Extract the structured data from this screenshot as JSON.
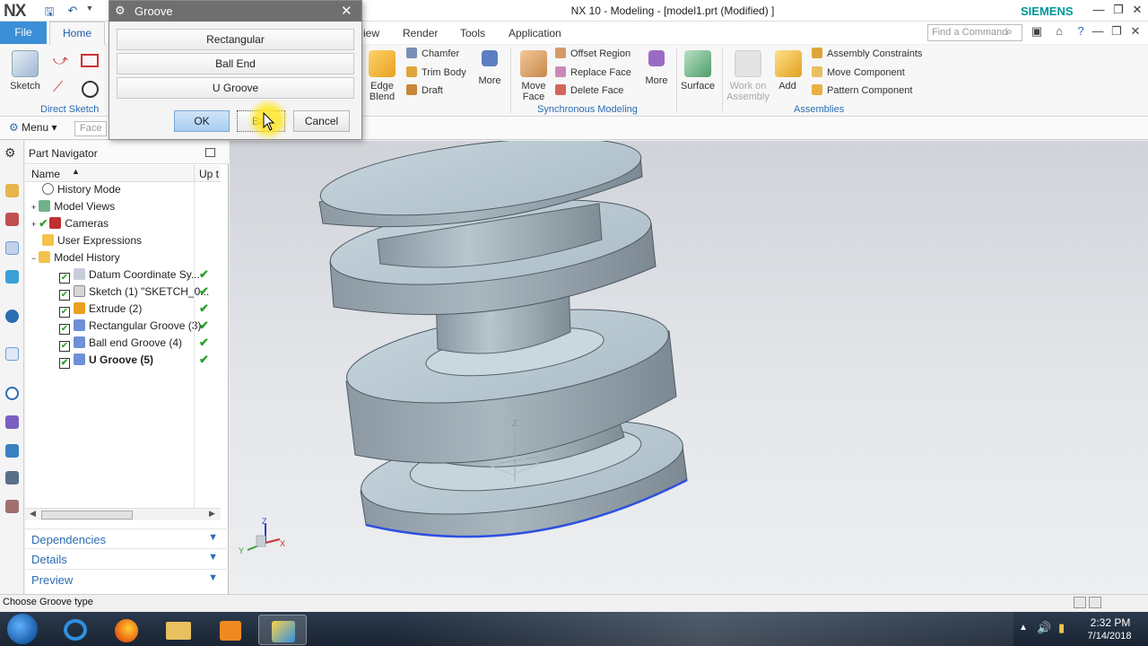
{
  "window": {
    "logo": "NX",
    "title": "NX 10 - Modeling - [model1.prt (Modified) ]",
    "brand": "SIEMENS",
    "accent": "#3b8fd6",
    "brand_color": "#00969a"
  },
  "ribbon_tabs": {
    "file": "File",
    "home": "Home",
    "view_partial": "iew",
    "render": "Render",
    "tools": "Tools",
    "application": "Application",
    "find_placeholder": "Find a Command"
  },
  "ribbon": {
    "sketch": "Sketch",
    "direct_sketch": "Direct Sketch",
    "edge_blend": "Edge Blend",
    "chamfer": "Chamfer",
    "trim_body": "Trim Body",
    "draft": "Draft",
    "more1": "More",
    "move_face": "Move Face",
    "offset_region": "Offset Region",
    "replace_face": "Replace Face",
    "delete_face": "Delete Face",
    "more2": "More",
    "synchronous_modeling": "Synchronous Modeling",
    "surface": "Surface",
    "work_on_assembly": "Work on Assembly",
    "add": "Add",
    "assembly_constraints": "Assembly Constraints",
    "move_component": "Move Component",
    "pattern_component": "Pattern Component",
    "assemblies": "Assemblies"
  },
  "commandbar": {
    "menu": "Menu",
    "filter_placeholder": "Face"
  },
  "navigator": {
    "title": "Part Navigator",
    "col_name": "Name",
    "col_up": "Up t",
    "items": [
      {
        "label": "History Mode"
      },
      {
        "label": "Model Views"
      },
      {
        "label": "Cameras"
      },
      {
        "label": "User Expressions"
      },
      {
        "label": "Model History"
      },
      {
        "label": "Datum Coordinate Sy..."
      },
      {
        "label": "Sketch (1) \"SKETCH_0..."
      },
      {
        "label": "Extrude (2)"
      },
      {
        "label": "Rectangular Groove (3)"
      },
      {
        "label": "Ball end Groove (4)"
      },
      {
        "label": "U Groove (5)"
      }
    ],
    "sections": {
      "dependencies": "Dependencies",
      "details": "Details",
      "preview": "Preview"
    }
  },
  "viewport": {
    "axis_z": "Z",
    "axis_x": "X",
    "axis_y": "Y",
    "selection_color": "#2d4fe0"
  },
  "status": {
    "message": "Choose Groove type"
  },
  "taskbar": {
    "time": "2:32 PM",
    "date": "7/14/2018"
  },
  "dialog": {
    "title": "Groove",
    "options": [
      "Rectangular",
      "Ball End",
      "U Groove"
    ],
    "ok": "OK",
    "back_partial": "Ba",
    "cancel": "Cancel"
  }
}
